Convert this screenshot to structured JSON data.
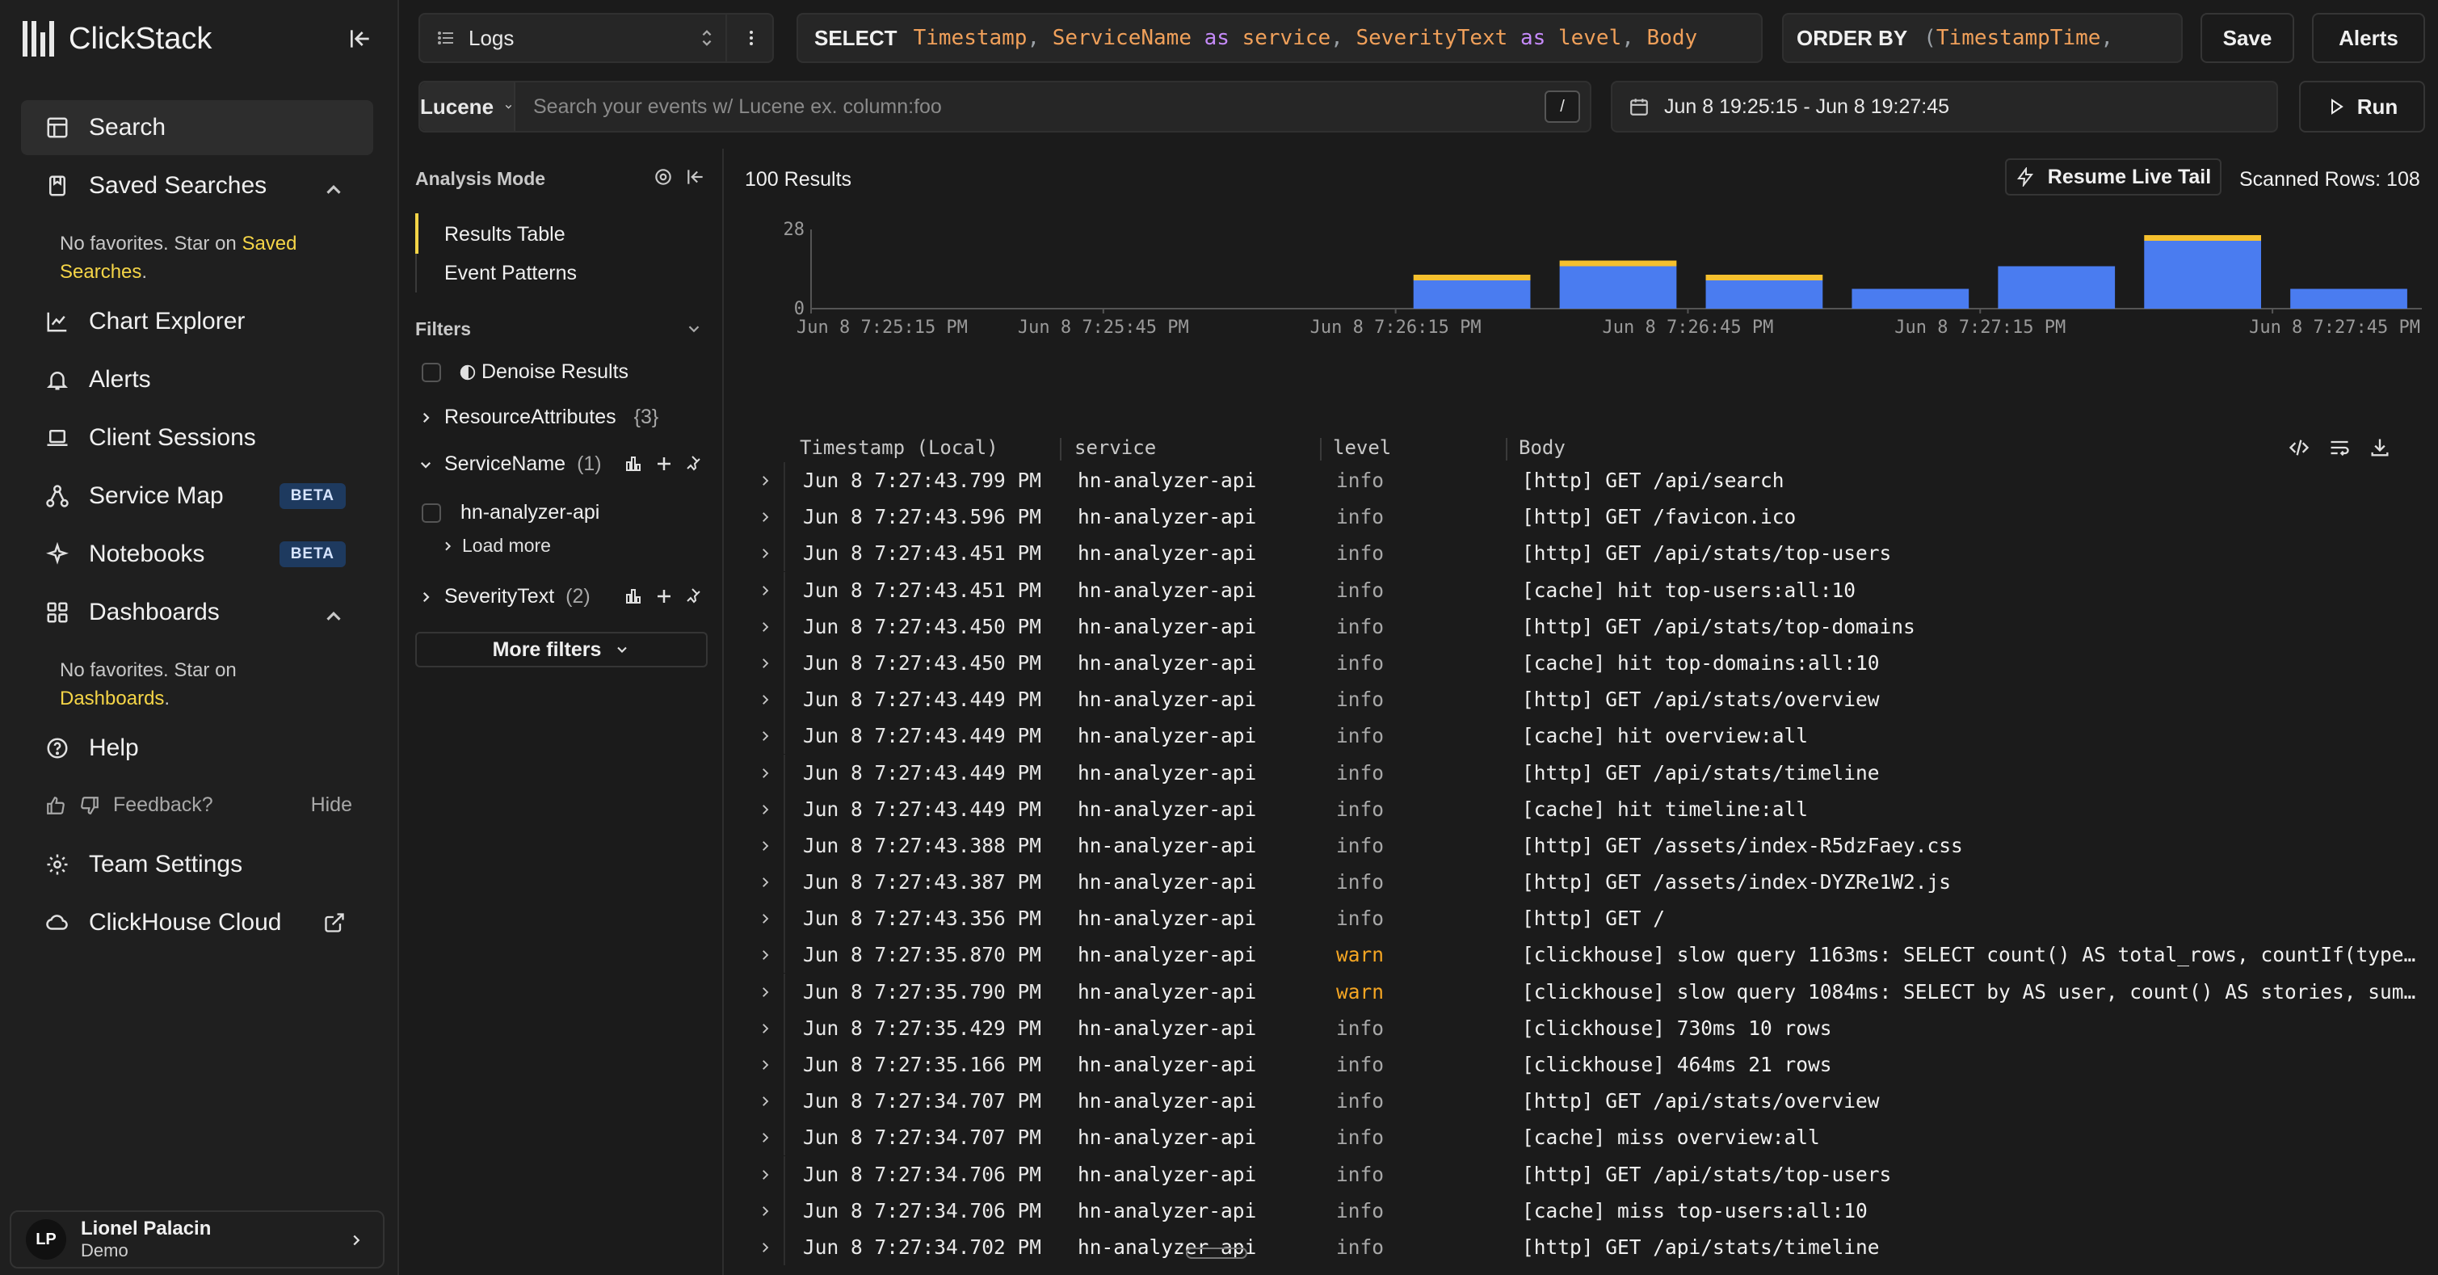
{
  "app": {
    "name": "ClickStack"
  },
  "sidebar": {
    "items": [
      {
        "label": "Search",
        "icon": "search-layout-icon"
      },
      {
        "label": "Saved Searches",
        "icon": "bookmark-icon"
      },
      {
        "label": "Chart Explorer",
        "icon": "chart-icon"
      },
      {
        "label": "Alerts",
        "icon": "bell-icon"
      },
      {
        "label": "Client Sessions",
        "icon": "laptop-icon"
      },
      {
        "label": "Service Map",
        "icon": "network-icon",
        "badge": "BETA"
      },
      {
        "label": "Notebooks",
        "icon": "sparkle-icon",
        "badge": "BETA"
      },
      {
        "label": "Dashboards",
        "icon": "grid-icon"
      },
      {
        "label": "Help",
        "icon": "help-icon"
      },
      {
        "label": "Team Settings",
        "icon": "gear-icon"
      },
      {
        "label": "ClickHouse Cloud",
        "icon": "cloud-icon"
      }
    ],
    "saved_hint": {
      "prefix": "No favorites. Star on ",
      "link": "Saved Searches",
      "suffix": "."
    },
    "dash_hint": {
      "prefix": "No favorites. Star on ",
      "link": "Dashboards",
      "suffix": "."
    },
    "feedback": {
      "label": "Feedback?",
      "hide": "Hide"
    },
    "user": {
      "initials": "LP",
      "name": "Lionel Palacin",
      "team": "Demo"
    }
  },
  "topbar": {
    "source": "Logs",
    "select_kw": "SELECT",
    "select_tokens": [
      {
        "t": "Timestamp",
        "c": "col"
      },
      {
        "t": ", ",
        "c": "p"
      },
      {
        "t": "ServiceName",
        "c": "col"
      },
      {
        "t": " as ",
        "c": "as"
      },
      {
        "t": "service",
        "c": "col"
      },
      {
        "t": ", ",
        "c": "p"
      },
      {
        "t": "SeverityText",
        "c": "col"
      },
      {
        "t": " as ",
        "c": "as"
      },
      {
        "t": "level",
        "c": "col"
      },
      {
        "t": ", ",
        "c": "p"
      },
      {
        "t": "Body",
        "c": "col"
      }
    ],
    "order_kw": "ORDER BY",
    "order_tokens": [
      {
        "t": "(",
        "c": "p"
      },
      {
        "t": "TimestampTime",
        "c": "col"
      },
      {
        "t": ",",
        "c": "p"
      }
    ],
    "save": "Save",
    "alerts": "Alerts",
    "query_lang": "Lucene",
    "search_placeholder": "Search your events w/ Lucene ex. column:foo",
    "slash": "/",
    "time_range": "Jun 8 19:25:15 - Jun 8 19:27:45",
    "run": "Run"
  },
  "filters": {
    "analysis_mode": "Analysis Mode",
    "modes": [
      "Results Table",
      "Event Patterns"
    ],
    "filters_label": "Filters",
    "denoise": "Denoise Results",
    "groups": [
      {
        "name": "ResourceAttributes",
        "count": "{3}"
      },
      {
        "name": "ServiceName",
        "count": "(1)",
        "values": [
          "hn-analyzer-api"
        ]
      },
      {
        "name": "SeverityText",
        "count": "(2)"
      }
    ],
    "load_more": "Load more",
    "more_filters": "More filters"
  },
  "results": {
    "count": "100 Results",
    "live_tail": "Resume Live Tail",
    "scanned": "Scanned Rows: 108",
    "columns": [
      "Timestamp (Local)",
      "service",
      "level",
      "Body"
    ],
    "rows": [
      {
        "ts": "Jun 8 7:27:43.799 PM",
        "service": "hn-analyzer-api",
        "level": "info",
        "body": "[http] GET /api/search"
      },
      {
        "ts": "Jun 8 7:27:43.596 PM",
        "service": "hn-analyzer-api",
        "level": "info",
        "body": "[http] GET /favicon.ico"
      },
      {
        "ts": "Jun 8 7:27:43.451 PM",
        "service": "hn-analyzer-api",
        "level": "info",
        "body": "[http] GET /api/stats/top-users"
      },
      {
        "ts": "Jun 8 7:27:43.451 PM",
        "service": "hn-analyzer-api",
        "level": "info",
        "body": "[cache] hit top-users:all:10"
      },
      {
        "ts": "Jun 8 7:27:43.450 PM",
        "service": "hn-analyzer-api",
        "level": "info",
        "body": "[http] GET /api/stats/top-domains"
      },
      {
        "ts": "Jun 8 7:27:43.450 PM",
        "service": "hn-analyzer-api",
        "level": "info",
        "body": "[cache] hit top-domains:all:10"
      },
      {
        "ts": "Jun 8 7:27:43.449 PM",
        "service": "hn-analyzer-api",
        "level": "info",
        "body": "[http] GET /api/stats/overview"
      },
      {
        "ts": "Jun 8 7:27:43.449 PM",
        "service": "hn-analyzer-api",
        "level": "info",
        "body": "[cache] hit overview:all"
      },
      {
        "ts": "Jun 8 7:27:43.449 PM",
        "service": "hn-analyzer-api",
        "level": "info",
        "body": "[http] GET /api/stats/timeline"
      },
      {
        "ts": "Jun 8 7:27:43.449 PM",
        "service": "hn-analyzer-api",
        "level": "info",
        "body": "[cache] hit timeline:all"
      },
      {
        "ts": "Jun 8 7:27:43.388 PM",
        "service": "hn-analyzer-api",
        "level": "info",
        "body": "[http] GET /assets/index-R5dzFaey.css"
      },
      {
        "ts": "Jun 8 7:27:43.387 PM",
        "service": "hn-analyzer-api",
        "level": "info",
        "body": "[http] GET /assets/index-DYZRe1W2.js"
      },
      {
        "ts": "Jun 8 7:27:43.356 PM",
        "service": "hn-analyzer-api",
        "level": "info",
        "body": "[http] GET /"
      },
      {
        "ts": "Jun 8 7:27:35.870 PM",
        "service": "hn-analyzer-api",
        "level": "warn",
        "body": "[clickhouse] slow query 1163ms: SELECT count() AS total_rows, countIf(type …"
      },
      {
        "ts": "Jun 8 7:27:35.790 PM",
        "service": "hn-analyzer-api",
        "level": "warn",
        "body": "[clickhouse] slow query 1084ms: SELECT by AS user, count() AS stories, sum(…"
      },
      {
        "ts": "Jun 8 7:27:35.429 PM",
        "service": "hn-analyzer-api",
        "level": "info",
        "body": "[clickhouse] 730ms 10 rows"
      },
      {
        "ts": "Jun 8 7:27:35.166 PM",
        "service": "hn-analyzer-api",
        "level": "info",
        "body": "[clickhouse] 464ms 21 rows"
      },
      {
        "ts": "Jun 8 7:27:34.707 PM",
        "service": "hn-analyzer-api",
        "level": "info",
        "body": "[http] GET /api/stats/overview"
      },
      {
        "ts": "Jun 8 7:27:34.707 PM",
        "service": "hn-analyzer-api",
        "level": "info",
        "body": "[cache] miss overview:all"
      },
      {
        "ts": "Jun 8 7:27:34.706 PM",
        "service": "hn-analyzer-api",
        "level": "info",
        "body": "[http] GET /api/stats/top-users"
      },
      {
        "ts": "Jun 8 7:27:34.706 PM",
        "service": "hn-analyzer-api",
        "level": "info",
        "body": "[cache] miss top-users:all:10"
      },
      {
        "ts": "Jun 8 7:27:34.702 PM",
        "service": "hn-analyzer-api",
        "level": "info",
        "body": "[http] GET /api/stats/timeline"
      }
    ]
  },
  "chart_data": {
    "type": "bar",
    "stacked": true,
    "ylim": [
      0,
      28
    ],
    "yticks": [
      "0",
      "28"
    ],
    "xticks": [
      "Jun 8 7:25:15 PM",
      "Jun 8 7:25:45 PM",
      "Jun 8 7:26:15 PM",
      "Jun 8 7:26:45 PM",
      "Jun 8 7:27:15 PM",
      "Jun 8 7:27:45 PM"
    ],
    "categories": [
      "7:25:15",
      "7:25:30",
      "7:25:45",
      "7:26:00",
      "7:26:15",
      "7:26:30",
      "7:26:45",
      "7:27:00",
      "7:27:15",
      "7:27:30",
      "7:27:45"
    ],
    "series": [
      {
        "name": "info",
        "color": "#4a7cf0",
        "values": [
          0,
          0,
          0,
          0,
          10,
          15,
          10,
          7,
          15,
          24,
          7
        ]
      },
      {
        "name": "warn",
        "color": "#f5c02e",
        "values": [
          0,
          0,
          0,
          0,
          2,
          2,
          2,
          0,
          0,
          2,
          0
        ]
      }
    ],
    "grid": false
  },
  "colors": {
    "accent": "#f5d547",
    "info_bar": "#4a7cf0",
    "warn_bar": "#f5c02e",
    "warn_text": "#f5a623"
  }
}
